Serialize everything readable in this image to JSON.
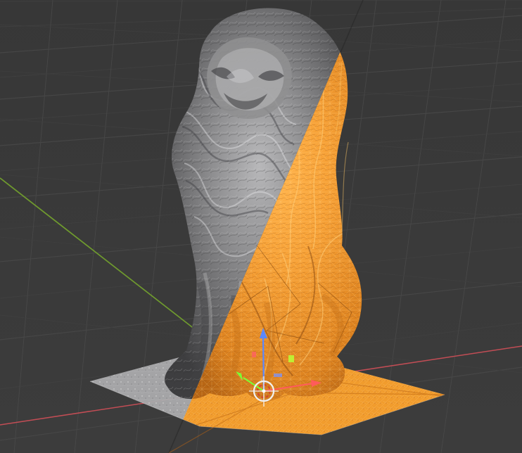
{
  "viewport": {
    "background": "#3a3a3a",
    "grid_color": "#4b4b4b",
    "x_axis_color": "#c24d55",
    "y_axis_color": "#6f9a2e",
    "selection_color": "#f09a2a",
    "mesh_color": "#8c8c8f",
    "gizmo": {
      "transform_icon": "3d-cursor-icon",
      "z_axis_color": "#5b88ff",
      "x_axis_color": "#ff5b5b",
      "y_axis_color": "#7cff35",
      "origin_color": "#f0f0f0"
    }
  }
}
